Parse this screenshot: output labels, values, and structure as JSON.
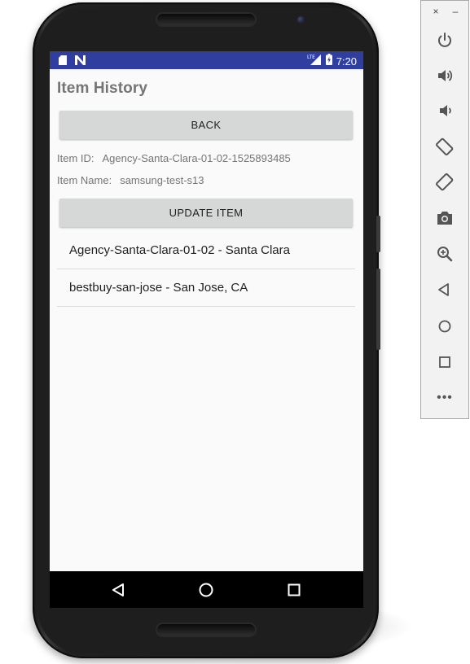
{
  "status_bar": {
    "time": "7:20",
    "network": "LTE"
  },
  "screen": {
    "title": "Item History",
    "back_button": "BACK",
    "item_id_label": "Item ID:",
    "item_id_value": "Agency-Santa-Clara-01-02-1525893485",
    "item_name_label": "Item Name:",
    "item_name_value": "samsung-test-s13",
    "update_button": "UPDATE ITEM",
    "history": [
      "Agency-Santa-Clara-01-02 - Santa Clara",
      "bestbuy-san-jose - San Jose, CA"
    ]
  },
  "emulator_toolbar": {
    "close": "×",
    "minimize": "–",
    "more": "•••",
    "tools": [
      "power-icon",
      "volume-up-icon",
      "volume-down-icon",
      "rotate-left-icon",
      "rotate-right-icon",
      "camera-icon",
      "zoom-icon",
      "back-icon",
      "home-icon",
      "overview-icon"
    ]
  },
  "colors": {
    "status_bar": "#303f9f",
    "screen_bg": "#fafafa",
    "button_bg": "#d6d7d7",
    "title_text": "#757575",
    "nav_bar": "#000000"
  }
}
